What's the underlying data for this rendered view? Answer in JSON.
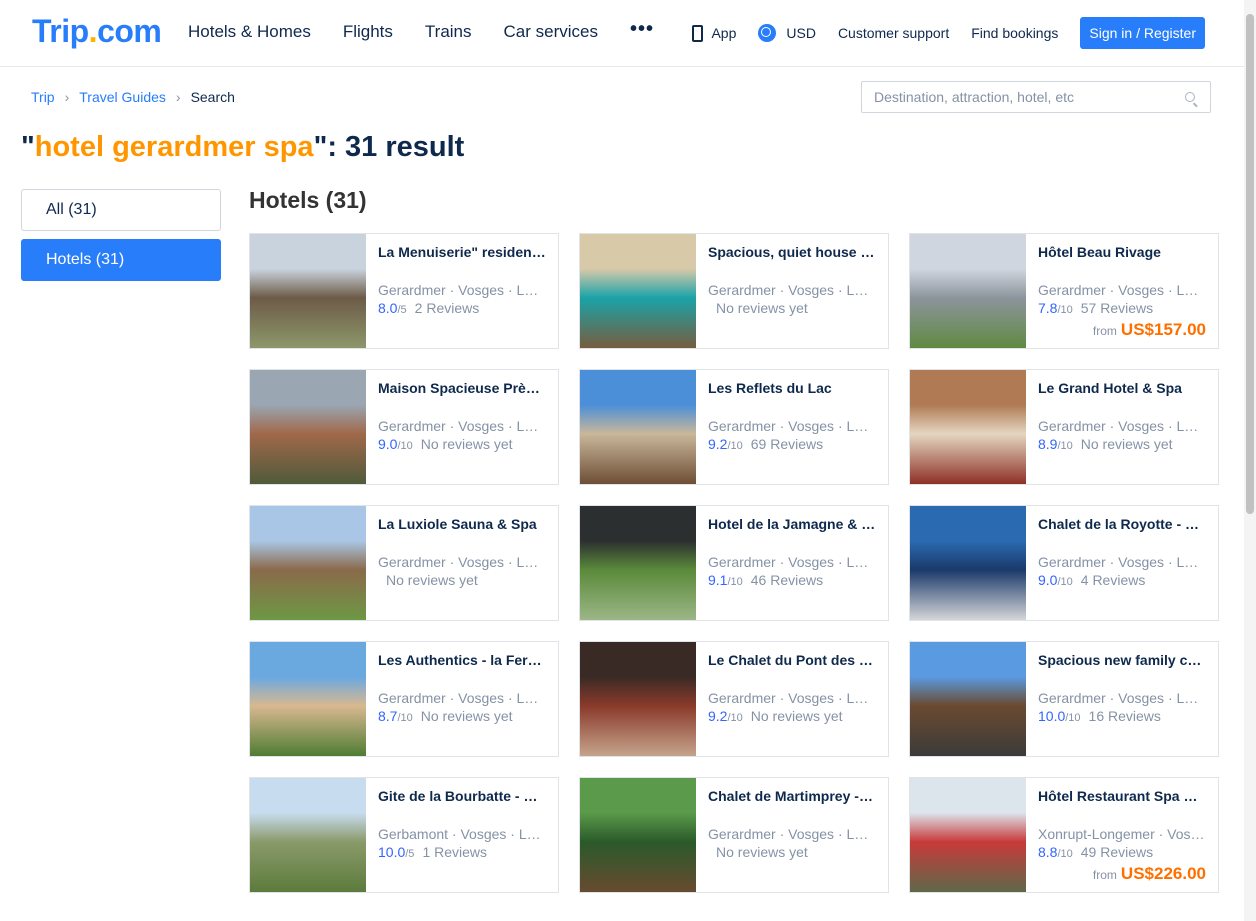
{
  "header": {
    "logo": "Trip",
    "logo_dot": ".",
    "logo_tail": "com",
    "nav": [
      "Hotels & Homes",
      "Flights",
      "Trains",
      "Car services"
    ],
    "more": "•••",
    "app": "App",
    "currency": "USD",
    "support": "Customer support",
    "bookings": "Find bookings",
    "signin": "Sign in / Register"
  },
  "breadcrumb": {
    "home": "Trip",
    "guides": "Travel Guides",
    "current": "Search",
    "sep": "›"
  },
  "search": {
    "placeholder": "Destination, attraction, hotel, etc"
  },
  "result": {
    "open_quote": "\"",
    "keyword": "hotel gerardmer spa",
    "rest": "\": 31 result"
  },
  "filters": {
    "all": "All (31)",
    "hotels": "Hotels (31)"
  },
  "section": {
    "title": "Hotels (31)"
  },
  "cards": [
    {
      "name": "La Menuiserie\" residence",
      "loc": "Gerardmer · Vosges · Lorraine",
      "score": "8.0",
      "outof": "/5",
      "reviews": "2 Reviews",
      "price": "",
      "colors": [
        "#c9d3de",
        "#6d5b48",
        "#8e9a6b"
      ]
    },
    {
      "name": "Spacious, quiet house with garden",
      "loc": "Gerardmer · Vosges · Lorraine",
      "score": "",
      "outof": "",
      "reviews": "No reviews yet",
      "price": "",
      "colors": [
        "#d8c9a8",
        "#1aa3a8",
        "#7a5a3a"
      ]
    },
    {
      "name": "Hôtel Beau Rivage",
      "loc": "Gerardmer · Vosges · Lorraine",
      "score": "7.8",
      "outof": "/10",
      "reviews": "57 Reviews",
      "price": "US$157.00",
      "colors": [
        "#cfd6df",
        "#8c949c",
        "#5e8a3e"
      ]
    },
    {
      "name": "Maison Spacieuse Près du Lac",
      "loc": "Gerardmer · Vosges · Lorraine",
      "score": "9.0",
      "outof": "/10",
      "reviews": "No reviews yet",
      "price": "",
      "colors": [
        "#9aa6b2",
        "#a0684a",
        "#4c5a3a"
      ]
    },
    {
      "name": "Les Reflets du Lac",
      "loc": "Gerardmer · Vosges · Lorraine",
      "score": "9.2",
      "outof": "/10",
      "reviews": "69 Reviews",
      "price": "",
      "colors": [
        "#4a8fd8",
        "#c9b79a",
        "#6b4a32"
      ]
    },
    {
      "name": "Le Grand Hotel & Spa",
      "loc": "Gerardmer · Vosges · Lorraine",
      "score": "8.9",
      "outof": "/10",
      "reviews": "No reviews yet",
      "price": "",
      "colors": [
        "#b07a55",
        "#e4d6c0",
        "#8a2a20"
      ]
    },
    {
      "name": "La Luxiole Sauna & Spa",
      "loc": "Gerardmer · Vosges · Lorraine",
      "score": "",
      "outof": "",
      "reviews": "No reviews yet",
      "price": "",
      "colors": [
        "#aac6e6",
        "#8a6a4a",
        "#6c9a44"
      ]
    },
    {
      "name": "Hotel de la Jamagne & Spa",
      "loc": "Gerardmer · Vosges · Lorraine",
      "score": "9.1",
      "outof": "/10",
      "reviews": "46 Reviews",
      "price": "",
      "colors": [
        "#2c2f30",
        "#5a8a3a",
        "#9fb88a"
      ]
    },
    {
      "name": "Chalet de la Royotte - Spa",
      "loc": "Gerardmer · Vosges · Lorraine",
      "score": "9.0",
      "outof": "/10",
      "reviews": "4 Reviews",
      "price": "",
      "colors": [
        "#2a6ab0",
        "#1a3a6a",
        "#dcdcdc"
      ]
    },
    {
      "name": "Les Authentics - la Ferme",
      "loc": "Gerardmer · Vosges · Lorraine",
      "score": "8.7",
      "outof": "/10",
      "reviews": "No reviews yet",
      "price": "",
      "colors": [
        "#6aa8e0",
        "#d8b890",
        "#4a7a30"
      ]
    },
    {
      "name": "Le Chalet du Pont des Fées",
      "loc": "Gerardmer · Vosges · Lorraine",
      "score": "9.2",
      "outof": "/10",
      "reviews": "No reviews yet",
      "price": "",
      "colors": [
        "#3a2a26",
        "#8a3a2a",
        "#c8a890"
      ]
    },
    {
      "name": "Spacious new family chalet",
      "loc": "Gerardmer · Vosges · Lorraine",
      "score": "10.0",
      "outof": "/10",
      "reviews": "16 Reviews",
      "price": "",
      "colors": [
        "#5a9ae0",
        "#6a4a30",
        "#3a3a3a"
      ]
    },
    {
      "name": "Gite de la Bourbatte - Spa",
      "loc": "Gerbamont · Vosges · Lorraine",
      "score": "10.0",
      "outof": "/5",
      "reviews": "1 Reviews",
      "price": "",
      "colors": [
        "#c8dcef",
        "#8a9a6a",
        "#5a7a3a"
      ]
    },
    {
      "name": "Chalet de Martimprey - Spa",
      "loc": "Gerardmer · Vosges · Lorraine",
      "score": "",
      "outof": "",
      "reviews": "No reviews yet",
      "price": "",
      "colors": [
        "#5a9a4a",
        "#2a5a2a",
        "#6a4a30"
      ]
    },
    {
      "name": "Hôtel Restaurant Spa Les Jardins",
      "loc": "Xonrupt-Longemer · Vosges · Lorraine",
      "score": "8.8",
      "outof": "/10",
      "reviews": "49 Reviews",
      "price": "US$226.00",
      "colors": [
        "#dce4ec",
        "#c83a3a",
        "#5a6a4a"
      ]
    }
  ],
  "price_from": "from"
}
